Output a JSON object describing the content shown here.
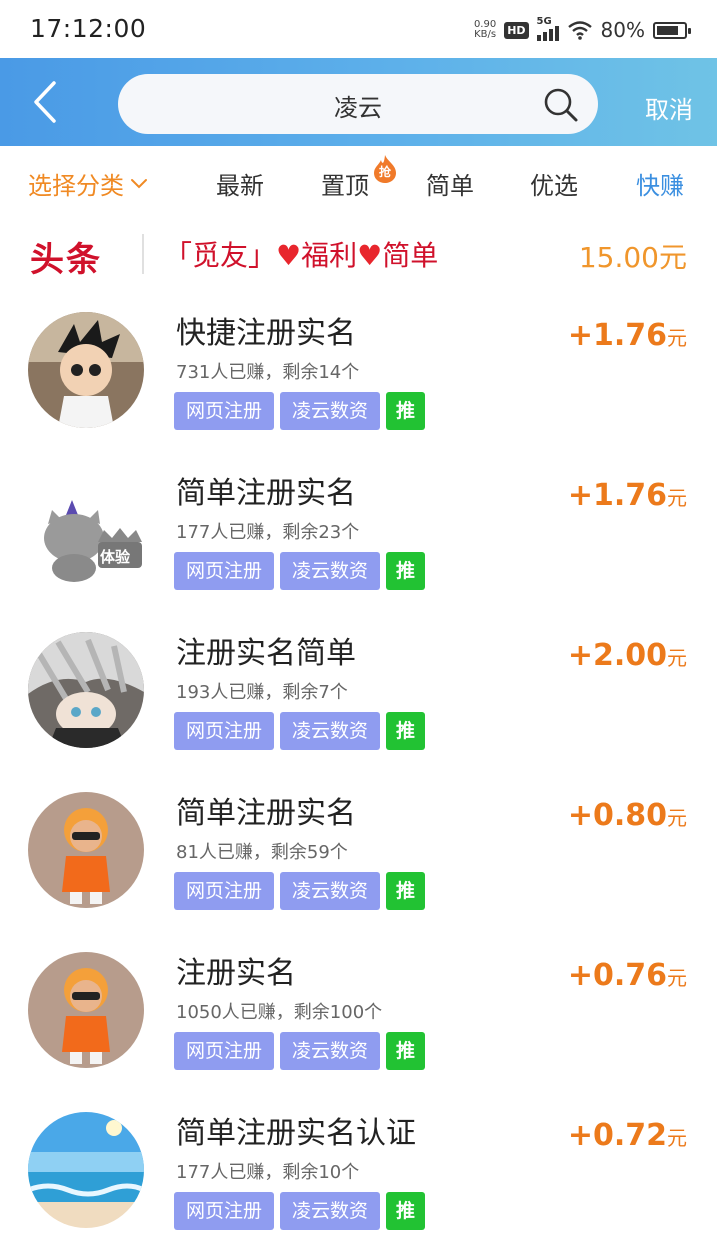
{
  "status_bar": {
    "time": "17:12:00",
    "net_speed_value": "0.90",
    "net_speed_unit": "KB/s",
    "hd_label": "HD",
    "network_label": "5G",
    "battery_percent": "80%",
    "battery_level": 0.8
  },
  "header": {
    "search_value": "凌云",
    "cancel_label": "取消"
  },
  "tabs": {
    "category_label": "选择分类",
    "items": [
      "最新",
      "置顶",
      "简单",
      "优选",
      "快赚"
    ],
    "hot_badge": "抢",
    "active_item": "快赚"
  },
  "headline": {
    "logo": "头条",
    "title_part1": "「觅友」",
    "title_part2": "福利",
    "title_part3": "简单",
    "reward": "15.00元"
  },
  "tasks": [
    {
      "title": "快捷注册实名",
      "meta": "731人已赚，剩余14个",
      "tags": [
        "网页注册",
        "凌云数资",
        "推"
      ],
      "reward_amount": "+1.76",
      "reward_unit": "元",
      "avatar": "cartoon-boy-avatar"
    },
    {
      "title": "简单注册实名",
      "meta": "177人已赚，剩余23个",
      "tags": [
        "网页注册",
        "凌云数资",
        "推"
      ],
      "reward_amount": "+1.76",
      "reward_unit": "元",
      "avatar": "cat-crown-avatar",
      "avatar_text": "体验"
    },
    {
      "title": "注册实名简单",
      "meta": "193人已赚，剩余7个",
      "tags": [
        "网页注册",
        "凌云数资",
        "推"
      ],
      "reward_amount": "+2.00",
      "reward_unit": "元",
      "avatar": "anime-girl-avatar"
    },
    {
      "title": "简单注册实名",
      "meta": "81人已赚，剩余59个",
      "tags": [
        "网页注册",
        "凌云数资",
        "推"
      ],
      "reward_amount": "+0.80",
      "reward_unit": "元",
      "avatar": "orange-figure-avatar"
    },
    {
      "title": "注册实名",
      "meta": "1050人已赚，剩余100个",
      "tags": [
        "网页注册",
        "凌云数资",
        "推"
      ],
      "reward_amount": "+0.76",
      "reward_unit": "元",
      "avatar": "orange-figure-avatar"
    },
    {
      "title": "简单注册实名认证",
      "meta": "177人已赚，剩余10个",
      "tags": [
        "网页注册",
        "凌云数资",
        "推"
      ],
      "reward_amount": "+0.72",
      "reward_unit": "元",
      "avatar": "ocean-avatar"
    }
  ],
  "colors": {
    "header_blue": "#4a9ae6",
    "accent_orange": "#f08a24",
    "reward_orange": "#ec7a1b",
    "headline_red": "#d0112b",
    "tag_purple": "#8f9cf0",
    "tag_green": "#22c233",
    "active_tab_blue": "#3b8fe0"
  }
}
